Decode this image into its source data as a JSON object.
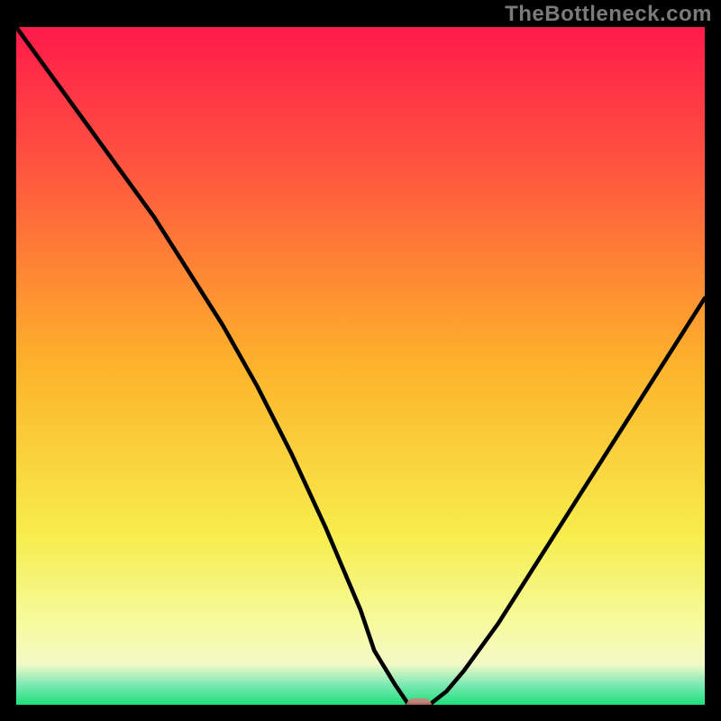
{
  "watermark": "TheBottleneck.com",
  "colors": {
    "gradient_top": "#ff1a4a",
    "gradient_q1": "#ff593e",
    "gradient_mid": "#fdb32b",
    "gradient_q3": "#f7ed4c",
    "gradient_low": "#f6fb9e",
    "gradient_base_yellow": "#f4f9c6",
    "gradient_teal": "#7de9b4",
    "gradient_green": "#1fe07a",
    "curve": "#000000",
    "marker": "#d27b7a"
  },
  "chart_data": {
    "type": "line",
    "title": "",
    "xlabel": "",
    "ylabel": "",
    "xlim": [
      0,
      100
    ],
    "ylim": [
      0,
      100
    ],
    "x": [
      0,
      5,
      10,
      15,
      20,
      25,
      30,
      35,
      40,
      45,
      50,
      52,
      55,
      57,
      58,
      60,
      62.5,
      65,
      70,
      75,
      80,
      85,
      90,
      95,
      100
    ],
    "values": [
      100,
      93,
      86,
      79,
      72,
      64,
      56,
      47,
      37,
      26,
      14,
      8,
      3,
      0,
      0,
      0,
      2,
      5,
      12,
      20,
      28,
      36,
      44,
      52,
      60
    ],
    "marker": {
      "x": 58.5,
      "y": 0,
      "radius": 1.4
    },
    "legend": []
  }
}
